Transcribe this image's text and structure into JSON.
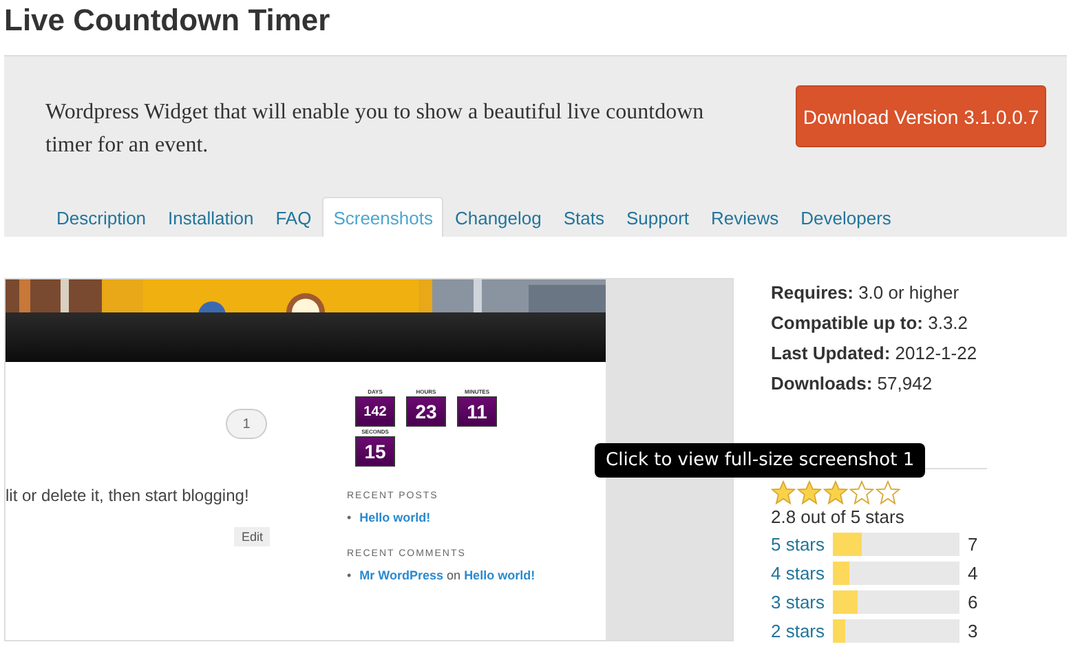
{
  "title": "Live Countdown Timer",
  "header": {
    "description": "Wordpress Widget that will enable you to show a beautiful live countdown timer for an event.",
    "download_button": "Download Version 3.1.0.0.7"
  },
  "tabs": [
    {
      "label": "Description",
      "selected": false
    },
    {
      "label": "Installation",
      "selected": false
    },
    {
      "label": "FAQ",
      "selected": false
    },
    {
      "label": "Screenshots",
      "selected": true
    },
    {
      "label": "Changelog",
      "selected": false
    },
    {
      "label": "Stats",
      "selected": false
    },
    {
      "label": "Support",
      "selected": false
    },
    {
      "label": "Reviews",
      "selected": false
    },
    {
      "label": "Developers",
      "selected": false
    }
  ],
  "screenshot": {
    "comment_count": "1",
    "post_text": "lit or delete it, then start blogging!",
    "edit_button": "Edit",
    "countdown": [
      {
        "label": "DAYS",
        "value": "142"
      },
      {
        "label": "HOURS",
        "value": "23"
      },
      {
        "label": "MINUTES",
        "value": "11"
      },
      {
        "label": "SECONDS",
        "value": "15"
      }
    ],
    "recent_posts": {
      "heading": "RECENT POSTS",
      "items": [
        {
          "bullet": "•",
          "title": "Hello world!"
        }
      ]
    },
    "recent_comments": {
      "heading": "RECENT COMMENTS",
      "items": [
        {
          "bullet": "•",
          "author": "Mr WordPress",
          "joiner": "on",
          "post": "Hello world!"
        }
      ]
    },
    "tooltip": "Click to view full-size screenshot 1"
  },
  "meta": [
    {
      "label": "Requires:",
      "value": "3.0 or higher"
    },
    {
      "label": "Compatible up to:",
      "value": "3.3.2"
    },
    {
      "label": "Last Updated:",
      "value": "2012-1-22"
    },
    {
      "label": "Downloads:",
      "value": "57,942"
    }
  ],
  "ratings": {
    "stars": 3,
    "summary": "2.8 out of 5 stars",
    "rows": [
      {
        "label": "5 stars",
        "level": 0.23,
        "count": "7"
      },
      {
        "label": "4 stars",
        "level": 0.13,
        "count": "4"
      },
      {
        "label": "3 stars",
        "level": 0.2,
        "count": "6"
      },
      {
        "label": "2 stars",
        "level": 0.1,
        "count": "3"
      }
    ]
  }
}
